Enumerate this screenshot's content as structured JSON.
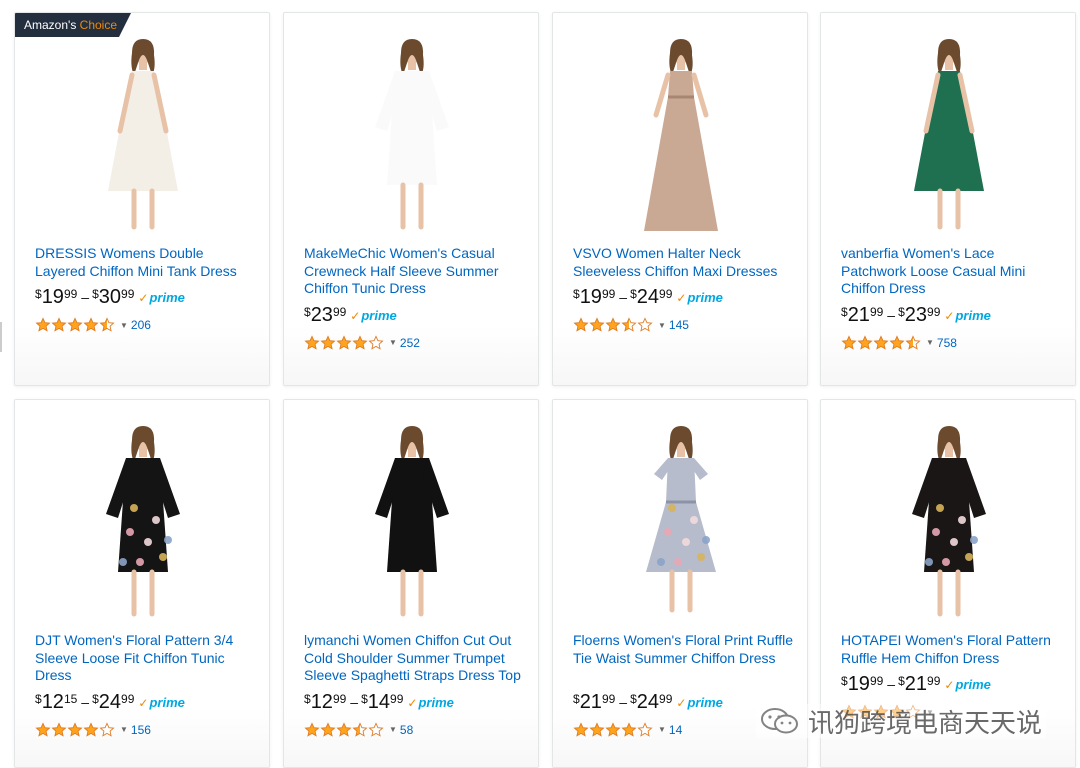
{
  "badge": {
    "prefix": "Amazon's",
    "suffix": "Choice"
  },
  "prime_label": "prime",
  "prime_check": "✓",
  "currency": "$",
  "colors": {
    "link": "#0066c0",
    "star": "#ffa41c",
    "prime": "#00a8e1",
    "badge_bg": "#232f3e",
    "badge_accent": "#f08804"
  },
  "products": [
    {
      "title": "DRESSIS Womens Double Layered Chiffon Mini Tank Dress",
      "price_low": {
        "whole": "19",
        "frac": "99"
      },
      "price_high": {
        "whole": "30",
        "frac": "99"
      },
      "rating": 4.5,
      "reviews": "206",
      "dress_color": "#f3efe6",
      "dress_style": "tank",
      "badge": true
    },
    {
      "title": "MakeMeChic Women's Casual Crewneck Half Sleeve Summer Chiffon Tunic Dress",
      "price_low": {
        "whole": "23",
        "frac": "99"
      },
      "price_high": null,
      "rating": 4.0,
      "reviews": "252",
      "dress_color": "#fafafa",
      "dress_style": "sleeve"
    },
    {
      "title": "VSVO Women Halter Neck Sleeveless Chiffon Maxi Dresses",
      "price_low": {
        "whole": "19",
        "frac": "99"
      },
      "price_high": {
        "whole": "24",
        "frac": "99"
      },
      "rating": 3.5,
      "reviews": "145",
      "dress_color": "#c9a894",
      "dress_style": "maxi"
    },
    {
      "title": "vanberfia Women's Lace Patchwork Loose Casual Mini Chiffon Dress",
      "price_low": {
        "whole": "21",
        "frac": "99"
      },
      "price_high": {
        "whole": "23",
        "frac": "99"
      },
      "rating": 4.5,
      "reviews": "758",
      "dress_color": "#1e7050",
      "dress_style": "tank"
    },
    {
      "title": "DJT Women's Floral Pattern 3/4 Sleeve Loose Fit Chiffon Tunic Dress",
      "price_low": {
        "whole": "12",
        "frac": "15"
      },
      "price_high": {
        "whole": "24",
        "frac": "99"
      },
      "rating": 4.0,
      "reviews": "156",
      "dress_color": "#141414",
      "dress_style": "sleeve",
      "floral": true
    },
    {
      "title": "lymanchi Women Chiffon Cut Out Cold Shoulder Summer Trumpet Sleeve Spaghetti Straps Dress Top",
      "price_low": {
        "whole": "12",
        "frac": "99"
      },
      "price_high": {
        "whole": "14",
        "frac": "99"
      },
      "rating": 3.5,
      "reviews": "58",
      "dress_color": "#111111",
      "dress_style": "sleeve"
    },
    {
      "title": "Floerns Women's Floral Print Ruffle Tie Waist Summer Chiffon Dress",
      "price_low": {
        "whole": "21",
        "frac": "99"
      },
      "price_high": {
        "whole": "24",
        "frac": "99"
      },
      "rating": 4.0,
      "reviews": "14",
      "dress_color": "#b6bccb",
      "dress_style": "midi",
      "floral": true
    },
    {
      "title": "HOTAPEI Women's Floral Pattern Ruffle Hem Chiffon Dress",
      "price_low": {
        "whole": "19",
        "frac": "99"
      },
      "price_high": {
        "whole": "21",
        "frac": "99"
      },
      "rating": 4.0,
      "reviews": "",
      "dress_color": "#1a1616",
      "dress_style": "sleeve",
      "floral": true
    }
  ],
  "watermark": {
    "text": "讯狗跨境电商天天说"
  }
}
